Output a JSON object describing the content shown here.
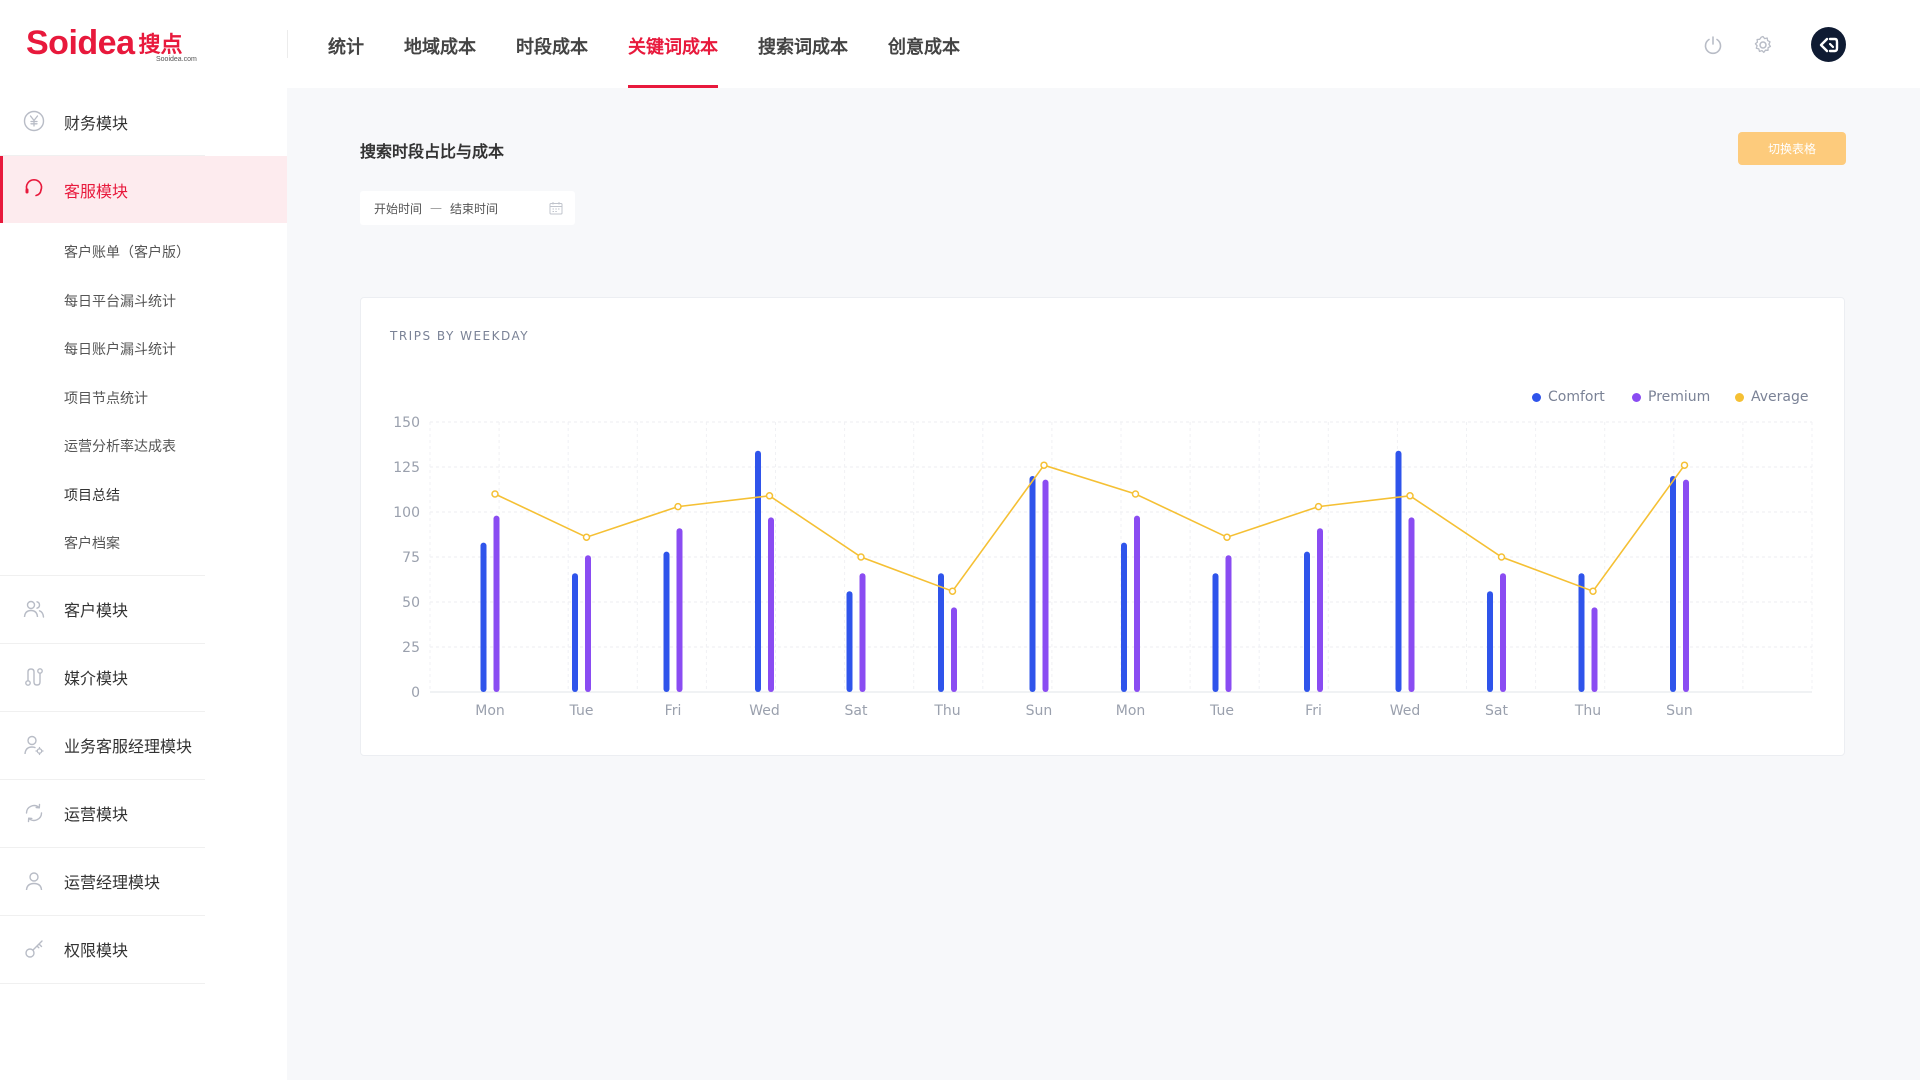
{
  "brand": {
    "logo_word": "Soidea",
    "logo_cn": "搜点",
    "logo_sub": "Sooidea.com",
    "color": "#e8193c"
  },
  "topnav": {
    "tabs": [
      {
        "label": "统计",
        "active": false
      },
      {
        "label": "地域成本",
        "active": false
      },
      {
        "label": "时段成本",
        "active": false
      },
      {
        "label": "关键词成本",
        "active": true
      },
      {
        "label": "搜索词成本",
        "active": false
      },
      {
        "label": "创意成本",
        "active": false
      }
    ],
    "icons": [
      "power-icon",
      "settings-gear-icon",
      "user-avatar"
    ]
  },
  "sidebar": {
    "items": [
      {
        "label": "财务模块",
        "icon": "yen-circle-icon",
        "active": false
      },
      {
        "label": "客服模块",
        "icon": "headset-icon",
        "active": true
      },
      {
        "label": "客户模块",
        "icon": "users-icon",
        "active": false
      },
      {
        "label": "媒介模块",
        "icon": "route-icon",
        "active": false
      },
      {
        "label": "业务客服经理模块",
        "icon": "user-settings-icon",
        "active": false
      },
      {
        "label": "运营模块",
        "icon": "cycle-icon",
        "active": false
      },
      {
        "label": "运营经理模块",
        "icon": "user-icon",
        "active": false
      },
      {
        "label": "权限模块",
        "icon": "key-icon",
        "active": false
      }
    ],
    "submenu": [
      {
        "label": "客户账单（客户版）"
      },
      {
        "label": "每日平台漏斗统计"
      },
      {
        "label": "每日账户漏斗统计"
      },
      {
        "label": "项目节点统计"
      },
      {
        "label": "运营分析率达成表"
      },
      {
        "label": "项目总结"
      },
      {
        "label": "客户档案"
      }
    ]
  },
  "main": {
    "section_title": "搜索时段占比与成本",
    "switch_button": "切换表格",
    "date_range": {
      "start_placeholder": "开始时间",
      "separator": "—",
      "end_placeholder": "结束时间"
    },
    "chart_title": "TRIPS BY WEEKDAY"
  },
  "chart_data": {
    "type": "bar",
    "title": "TRIPS BY WEEKDAY",
    "categories": [
      "Mon",
      "Tue",
      "Fri",
      "Wed",
      "Sat",
      "Thu",
      "Sun",
      "Mon",
      "Tue",
      "Fri",
      "Wed",
      "Sat",
      "Thu",
      "Sun"
    ],
    "series": [
      {
        "name": "Comfort",
        "type": "bar",
        "color": "#2f54eb",
        "values": [
          83,
          66,
          78,
          134,
          56,
          66,
          120,
          83,
          66,
          78,
          134,
          56,
          66,
          120
        ]
      },
      {
        "name": "Premium",
        "type": "bar",
        "color": "#8a4cf2",
        "values": [
          98,
          76,
          91,
          97,
          66,
          47,
          118,
          98,
          76,
          91,
          97,
          66,
          47,
          118
        ]
      },
      {
        "name": "Average",
        "type": "line",
        "color": "#f5c034",
        "values": [
          110,
          86,
          103,
          109,
          75,
          56,
          126,
          110,
          86,
          103,
          109,
          75,
          56,
          126
        ]
      }
    ],
    "ylim": [
      0,
      150
    ],
    "yticks": [
      0,
      25,
      50,
      75,
      100,
      125,
      150
    ],
    "xlabel": "",
    "ylabel": "",
    "legend": "top-right",
    "grid": true
  }
}
